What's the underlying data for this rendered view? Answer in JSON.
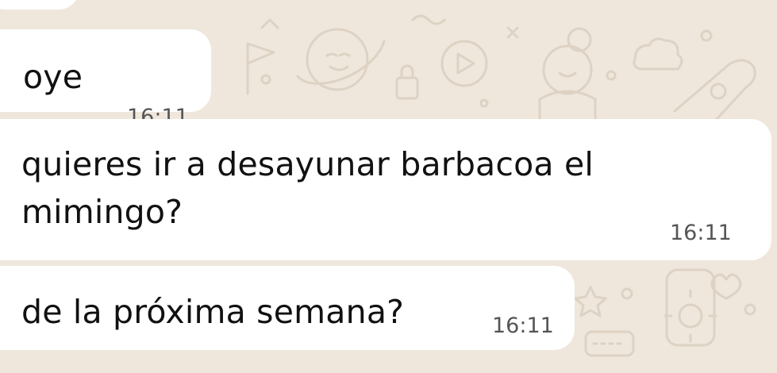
{
  "chat": {
    "background_color": "#efe7dc",
    "bubble_color": "#ffffff",
    "messages": [
      {
        "line1": "oye",
        "time": "16:11"
      },
      {
        "line1": "quieres ir a desayunar barbacoa el",
        "line2": "mimingo?",
        "time": "16:11"
      },
      {
        "line1": "de la próxima semana?",
        "time": "16:11"
      }
    ]
  }
}
